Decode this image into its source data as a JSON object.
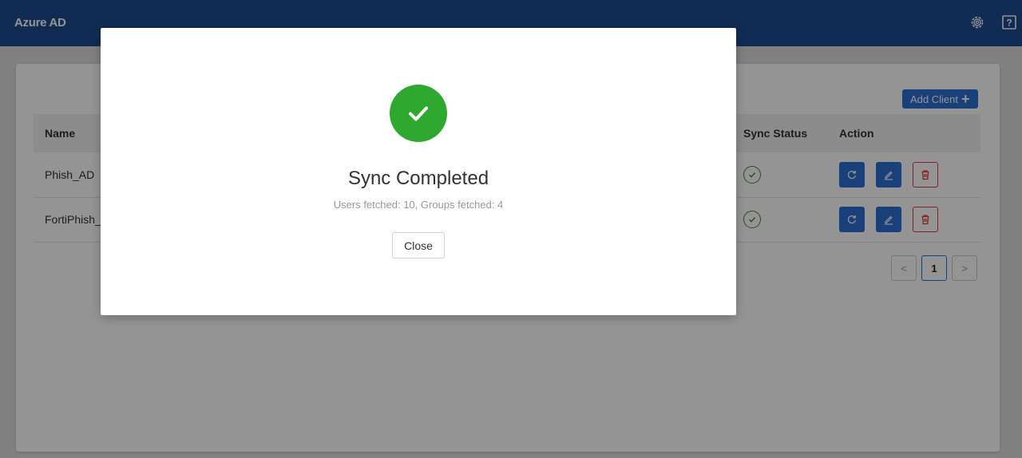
{
  "header": {
    "title": "Azure AD",
    "settings_icon": "gear-icon",
    "help_icon": "help-icon",
    "help_glyph": "?"
  },
  "clients": {
    "add_button_label": "Add Client",
    "add_button_plus": "+",
    "columns": [
      "Name",
      "Sync Status",
      "Action"
    ],
    "rows": [
      {
        "name": "Phish_AD",
        "sync_status": "synced"
      },
      {
        "name": "FortiPhish_AD",
        "sync_status": "synced"
      }
    ],
    "pagination": {
      "prev": "<",
      "current": "1",
      "next": ">"
    }
  },
  "modal": {
    "icon": "check-icon",
    "title": "Sync Completed",
    "message": "Users fetched: 10, Groups fetched: 4",
    "close_label": "Close"
  },
  "colors": {
    "header_bg": "#1e4c8f",
    "primary": "#2d6fd3",
    "success": "#2ea82e",
    "danger": "#e03a3a"
  }
}
